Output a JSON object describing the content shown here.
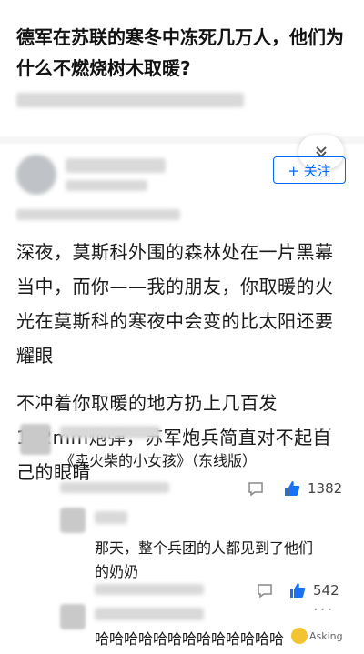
{
  "question": {
    "title": "德军在苏联的寒冬中冻死几万人，他们为什么不燃烧树木取暖?"
  },
  "author": {
    "follow_label": "+ 关注"
  },
  "answer": {
    "paragraphs": [
      "深夜，莫斯科外围的森林处在一片黑幕当中，而你——我的朋友，你取暖的火光在莫斯科的寒夜中会变的比太阳还要耀眼",
      "不冲着你取暖的地方扔上几百发152mm炮弹，苏军炮兵简直对不起自己的眼睛"
    ]
  },
  "comments": [
    {
      "text": "《卖火柴的小女孩》（东线版）",
      "likes": "1382"
    },
    {
      "text": "那天，整个兵团的人都见到了他们的奶奶",
      "likes": "542"
    },
    {
      "text": "哈哈哈哈哈哈哈哈哈哈哈哈哈"
    }
  ],
  "watermark": "Asking"
}
